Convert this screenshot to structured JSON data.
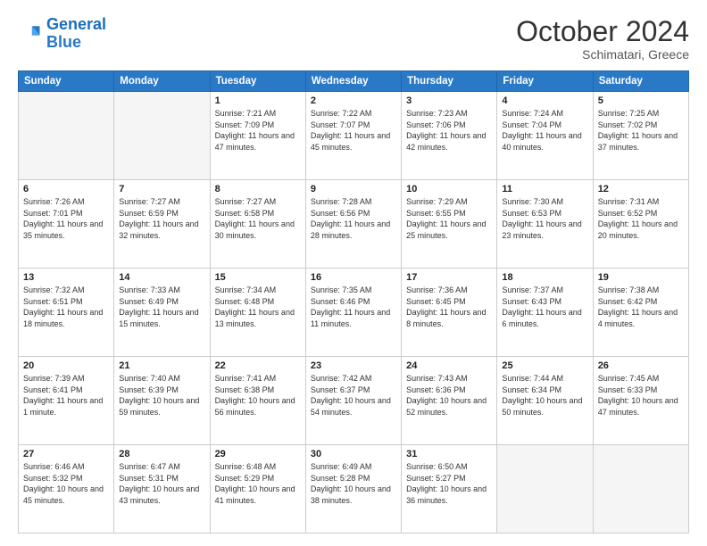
{
  "header": {
    "logo_general": "General",
    "logo_blue": "Blue",
    "month": "October 2024",
    "location": "Schimatari, Greece"
  },
  "weekdays": [
    "Sunday",
    "Monday",
    "Tuesday",
    "Wednesday",
    "Thursday",
    "Friday",
    "Saturday"
  ],
  "weeks": [
    [
      {
        "day": "",
        "sunrise": "",
        "sunset": "",
        "daylight": ""
      },
      {
        "day": "",
        "sunrise": "",
        "sunset": "",
        "daylight": ""
      },
      {
        "day": "1",
        "sunrise": "Sunrise: 7:21 AM",
        "sunset": "Sunset: 7:09 PM",
        "daylight": "Daylight: 11 hours and 47 minutes."
      },
      {
        "day": "2",
        "sunrise": "Sunrise: 7:22 AM",
        "sunset": "Sunset: 7:07 PM",
        "daylight": "Daylight: 11 hours and 45 minutes."
      },
      {
        "day": "3",
        "sunrise": "Sunrise: 7:23 AM",
        "sunset": "Sunset: 7:06 PM",
        "daylight": "Daylight: 11 hours and 42 minutes."
      },
      {
        "day": "4",
        "sunrise": "Sunrise: 7:24 AM",
        "sunset": "Sunset: 7:04 PM",
        "daylight": "Daylight: 11 hours and 40 minutes."
      },
      {
        "day": "5",
        "sunrise": "Sunrise: 7:25 AM",
        "sunset": "Sunset: 7:02 PM",
        "daylight": "Daylight: 11 hours and 37 minutes."
      }
    ],
    [
      {
        "day": "6",
        "sunrise": "Sunrise: 7:26 AM",
        "sunset": "Sunset: 7:01 PM",
        "daylight": "Daylight: 11 hours and 35 minutes."
      },
      {
        "day": "7",
        "sunrise": "Sunrise: 7:27 AM",
        "sunset": "Sunset: 6:59 PM",
        "daylight": "Daylight: 11 hours and 32 minutes."
      },
      {
        "day": "8",
        "sunrise": "Sunrise: 7:27 AM",
        "sunset": "Sunset: 6:58 PM",
        "daylight": "Daylight: 11 hours and 30 minutes."
      },
      {
        "day": "9",
        "sunrise": "Sunrise: 7:28 AM",
        "sunset": "Sunset: 6:56 PM",
        "daylight": "Daylight: 11 hours and 28 minutes."
      },
      {
        "day": "10",
        "sunrise": "Sunrise: 7:29 AM",
        "sunset": "Sunset: 6:55 PM",
        "daylight": "Daylight: 11 hours and 25 minutes."
      },
      {
        "day": "11",
        "sunrise": "Sunrise: 7:30 AM",
        "sunset": "Sunset: 6:53 PM",
        "daylight": "Daylight: 11 hours and 23 minutes."
      },
      {
        "day": "12",
        "sunrise": "Sunrise: 7:31 AM",
        "sunset": "Sunset: 6:52 PM",
        "daylight": "Daylight: 11 hours and 20 minutes."
      }
    ],
    [
      {
        "day": "13",
        "sunrise": "Sunrise: 7:32 AM",
        "sunset": "Sunset: 6:51 PM",
        "daylight": "Daylight: 11 hours and 18 minutes."
      },
      {
        "day": "14",
        "sunrise": "Sunrise: 7:33 AM",
        "sunset": "Sunset: 6:49 PM",
        "daylight": "Daylight: 11 hours and 15 minutes."
      },
      {
        "day": "15",
        "sunrise": "Sunrise: 7:34 AM",
        "sunset": "Sunset: 6:48 PM",
        "daylight": "Daylight: 11 hours and 13 minutes."
      },
      {
        "day": "16",
        "sunrise": "Sunrise: 7:35 AM",
        "sunset": "Sunset: 6:46 PM",
        "daylight": "Daylight: 11 hours and 11 minutes."
      },
      {
        "day": "17",
        "sunrise": "Sunrise: 7:36 AM",
        "sunset": "Sunset: 6:45 PM",
        "daylight": "Daylight: 11 hours and 8 minutes."
      },
      {
        "day": "18",
        "sunrise": "Sunrise: 7:37 AM",
        "sunset": "Sunset: 6:43 PM",
        "daylight": "Daylight: 11 hours and 6 minutes."
      },
      {
        "day": "19",
        "sunrise": "Sunrise: 7:38 AM",
        "sunset": "Sunset: 6:42 PM",
        "daylight": "Daylight: 11 hours and 4 minutes."
      }
    ],
    [
      {
        "day": "20",
        "sunrise": "Sunrise: 7:39 AM",
        "sunset": "Sunset: 6:41 PM",
        "daylight": "Daylight: 11 hours and 1 minute."
      },
      {
        "day": "21",
        "sunrise": "Sunrise: 7:40 AM",
        "sunset": "Sunset: 6:39 PM",
        "daylight": "Daylight: 10 hours and 59 minutes."
      },
      {
        "day": "22",
        "sunrise": "Sunrise: 7:41 AM",
        "sunset": "Sunset: 6:38 PM",
        "daylight": "Daylight: 10 hours and 56 minutes."
      },
      {
        "day": "23",
        "sunrise": "Sunrise: 7:42 AM",
        "sunset": "Sunset: 6:37 PM",
        "daylight": "Daylight: 10 hours and 54 minutes."
      },
      {
        "day": "24",
        "sunrise": "Sunrise: 7:43 AM",
        "sunset": "Sunset: 6:36 PM",
        "daylight": "Daylight: 10 hours and 52 minutes."
      },
      {
        "day": "25",
        "sunrise": "Sunrise: 7:44 AM",
        "sunset": "Sunset: 6:34 PM",
        "daylight": "Daylight: 10 hours and 50 minutes."
      },
      {
        "day": "26",
        "sunrise": "Sunrise: 7:45 AM",
        "sunset": "Sunset: 6:33 PM",
        "daylight": "Daylight: 10 hours and 47 minutes."
      }
    ],
    [
      {
        "day": "27",
        "sunrise": "Sunrise: 6:46 AM",
        "sunset": "Sunset: 5:32 PM",
        "daylight": "Daylight: 10 hours and 45 minutes."
      },
      {
        "day": "28",
        "sunrise": "Sunrise: 6:47 AM",
        "sunset": "Sunset: 5:31 PM",
        "daylight": "Daylight: 10 hours and 43 minutes."
      },
      {
        "day": "29",
        "sunrise": "Sunrise: 6:48 AM",
        "sunset": "Sunset: 5:29 PM",
        "daylight": "Daylight: 10 hours and 41 minutes."
      },
      {
        "day": "30",
        "sunrise": "Sunrise: 6:49 AM",
        "sunset": "Sunset: 5:28 PM",
        "daylight": "Daylight: 10 hours and 38 minutes."
      },
      {
        "day": "31",
        "sunrise": "Sunrise: 6:50 AM",
        "sunset": "Sunset: 5:27 PM",
        "daylight": "Daylight: 10 hours and 36 minutes."
      },
      {
        "day": "",
        "sunrise": "",
        "sunset": "",
        "daylight": ""
      },
      {
        "day": "",
        "sunrise": "",
        "sunset": "",
        "daylight": ""
      }
    ]
  ]
}
